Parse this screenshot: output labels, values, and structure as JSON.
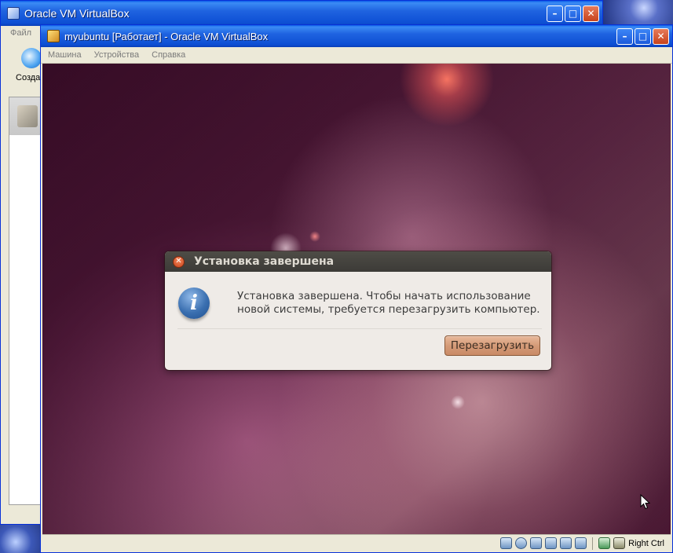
{
  "back_window": {
    "title": "Oracle VM VirtualBox",
    "menu_first": "Файл",
    "toolbar_new_label": "Созда"
  },
  "vm_window": {
    "title": "myubuntu [Работает] - Oracle VM VirtualBox",
    "menu": [
      "Машина",
      "Устройства",
      "Справка"
    ],
    "status_bar": {
      "host_key": "Right Ctrl",
      "icons": [
        "hard-disk-icon",
        "optical-drive-icon",
        "usb-icon",
        "network-icon",
        "shared-folders-icon",
        "display-icon",
        "mouse-integration-icon",
        "keyboard-capture-icon"
      ]
    }
  },
  "dialog": {
    "title": "Установка завершена",
    "message": "Установка завершена. Чтобы начать использование\nновой системы, требуется перезагрузить компьютер.",
    "restart_button": "Перезагрузить",
    "icon": "info-icon"
  },
  "colors": {
    "xp_title_blue": "#0d4fd4",
    "ubuntu_titlebar": "#3c3b37",
    "restart_button": "#d59b78",
    "dialog_bg": "#efebe7"
  }
}
